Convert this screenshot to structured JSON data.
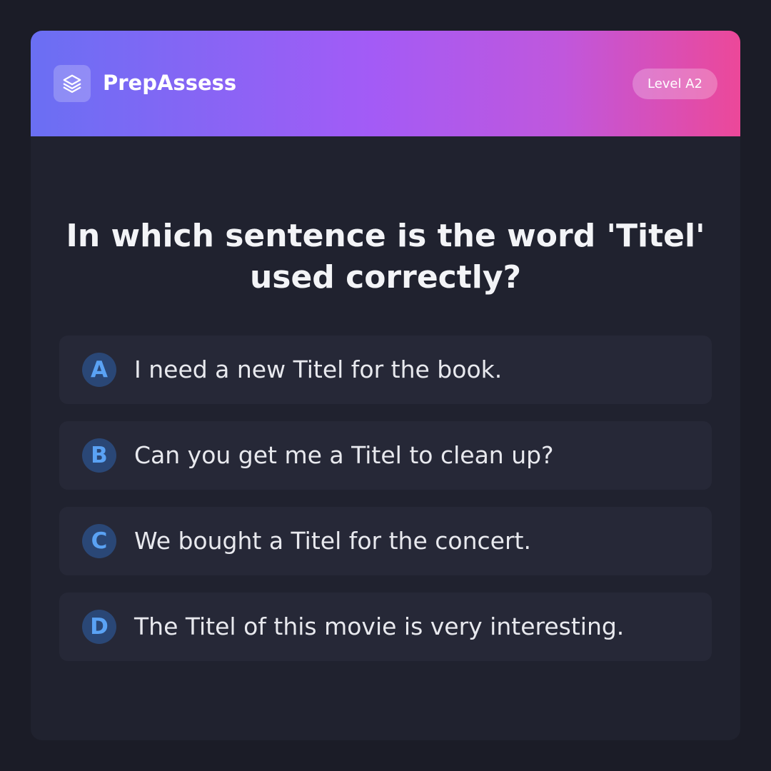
{
  "header": {
    "brand": "PrepAssess",
    "logo_icon": "layers-icon",
    "level_badge": "Level A2",
    "gradient_colors": [
      "#6a6ff3",
      "#a35bf6",
      "#ec4899"
    ]
  },
  "question": {
    "text": "In which sentence is the word 'Titel' used correctly?"
  },
  "options": [
    {
      "letter": "A",
      "text": "I need a new Titel for the book."
    },
    {
      "letter": "B",
      "text": "Can you get me a Titel to clean up?"
    },
    {
      "letter": "C",
      "text": "We bought a Titel for the concert."
    },
    {
      "letter": "D",
      "text": "The Titel of this movie is very interesting."
    }
  ],
  "colors": {
    "background": "#1b1c27",
    "card": "#20222f",
    "option_bg": "#262837",
    "letter_bg": "#2a4776",
    "letter_fg": "#5aa2f4"
  }
}
